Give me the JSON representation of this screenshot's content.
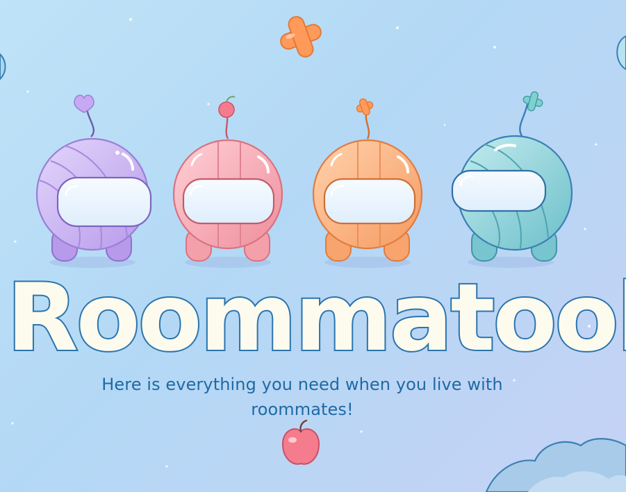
{
  "app": {
    "title": "Roommatool",
    "tagline": "Here is everything you need when you live with roommates!"
  },
  "colors": {
    "background_top": "#bfe3f7",
    "background_bottom": "#c6d2f5",
    "title_fill": "#fdfbee",
    "title_outline": "#2b74ad",
    "tagline": "#1f6aa3",
    "purple": "#c9b0f3",
    "pink": "#f7a9b3",
    "orange": "#fbb07c",
    "teal": "#8fd2d9",
    "visor": "#eef7ff"
  },
  "characters": [
    {
      "name": "purple-roommate",
      "antenna": "heart"
    },
    {
      "name": "pink-roommate",
      "antenna": "apple"
    },
    {
      "name": "orange-roommate",
      "antenna": "cross"
    },
    {
      "name": "teal-roommate",
      "antenna": "plus"
    }
  ],
  "decorations": [
    "orange-cross",
    "apple",
    "cloud"
  ]
}
